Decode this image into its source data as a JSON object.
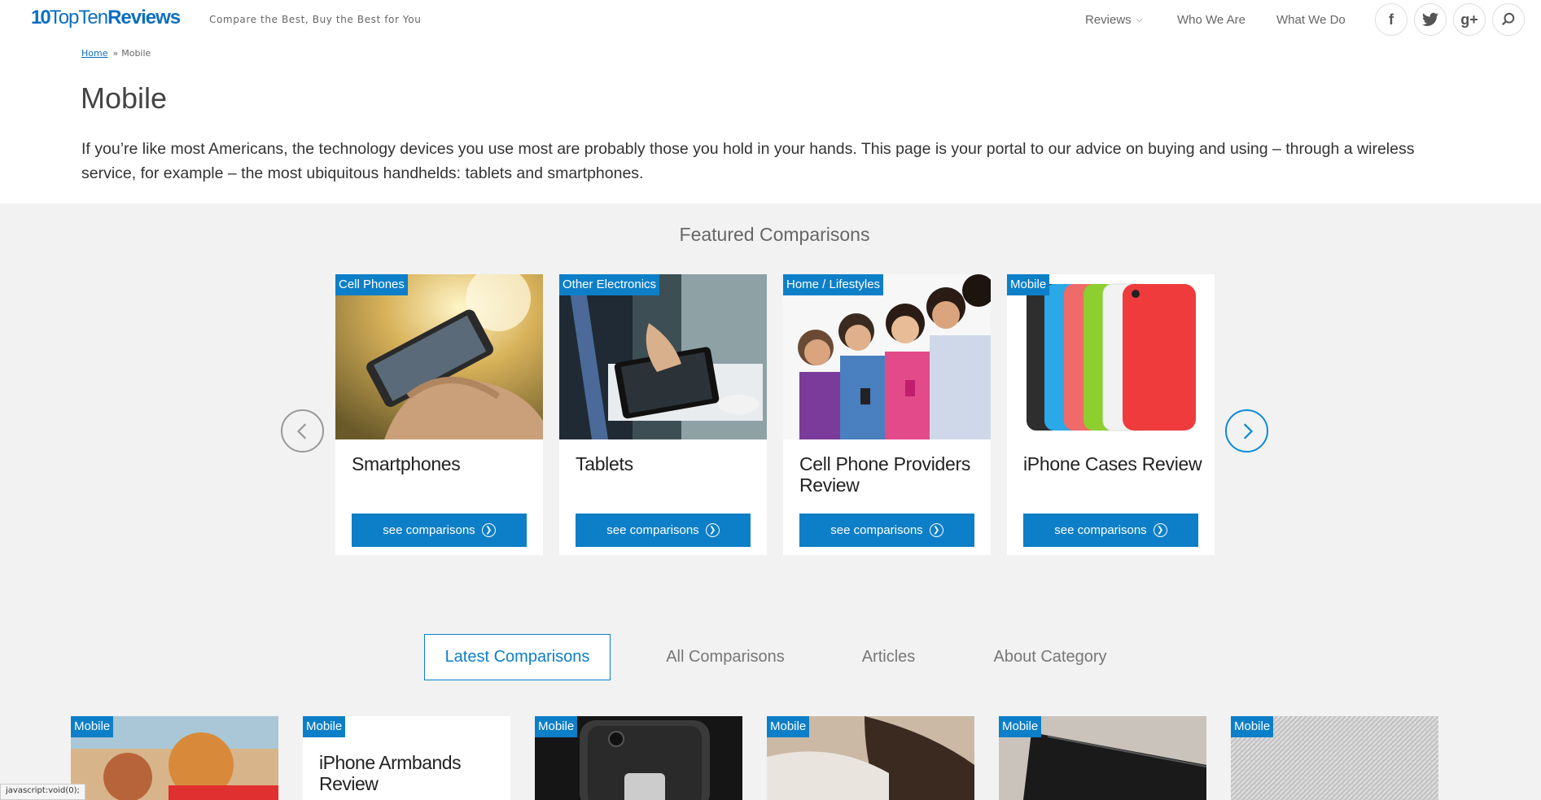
{
  "header": {
    "logo_number": "10",
    "logo_top": "TopTen",
    "logo_reviews": "Reviews",
    "tagline": "Compare the Best, Buy the Best for You",
    "nav": [
      {
        "label": "Reviews"
      },
      {
        "label": "Who We Are"
      },
      {
        "label": "What We Do"
      }
    ],
    "social": {
      "facebook": "f",
      "twitter": "t",
      "googleplus": "g+"
    }
  },
  "breadcrumb": {
    "home": "Home",
    "separator": "»",
    "current": "Mobile"
  },
  "page": {
    "title": "Mobile",
    "intro": "If you’re like most Americans, the technology devices you use most are probably those you hold in your hands. This page is your portal to our advice on buying and using – through a wireless service, for example – the most ubiquitous handhelds: tablets and smartphones."
  },
  "featured": {
    "title": "Featured Comparisons",
    "button_label": "see comparisons",
    "cards": [
      {
        "tag": "Cell Phones",
        "title": "Smartphones"
      },
      {
        "tag": "Other Electronics",
        "title": "Tablets"
      },
      {
        "tag": "Home / Lifestyles",
        "title": "Cell Phone Providers Review"
      },
      {
        "tag": "Mobile",
        "title": "iPhone Cases Review"
      }
    ]
  },
  "tabs": [
    {
      "label": "Latest Comparisons"
    },
    {
      "label": "All Comparisons"
    },
    {
      "label": "Articles"
    },
    {
      "label": "About Category"
    }
  ],
  "latest": {
    "cards": [
      {
        "tag": "Mobile",
        "title": ""
      },
      {
        "tag": "Mobile",
        "title": "iPhone Armbands Review"
      },
      {
        "tag": "Mobile",
        "title": ""
      },
      {
        "tag": "Mobile",
        "title": ""
      },
      {
        "tag": "Mobile",
        "title": ""
      },
      {
        "tag": "Mobile",
        "title": ""
      }
    ]
  },
  "status_bar": "javascript:void(0);",
  "colors": {
    "accent": "#0d7fc8",
    "band": "#f2f2f2"
  }
}
